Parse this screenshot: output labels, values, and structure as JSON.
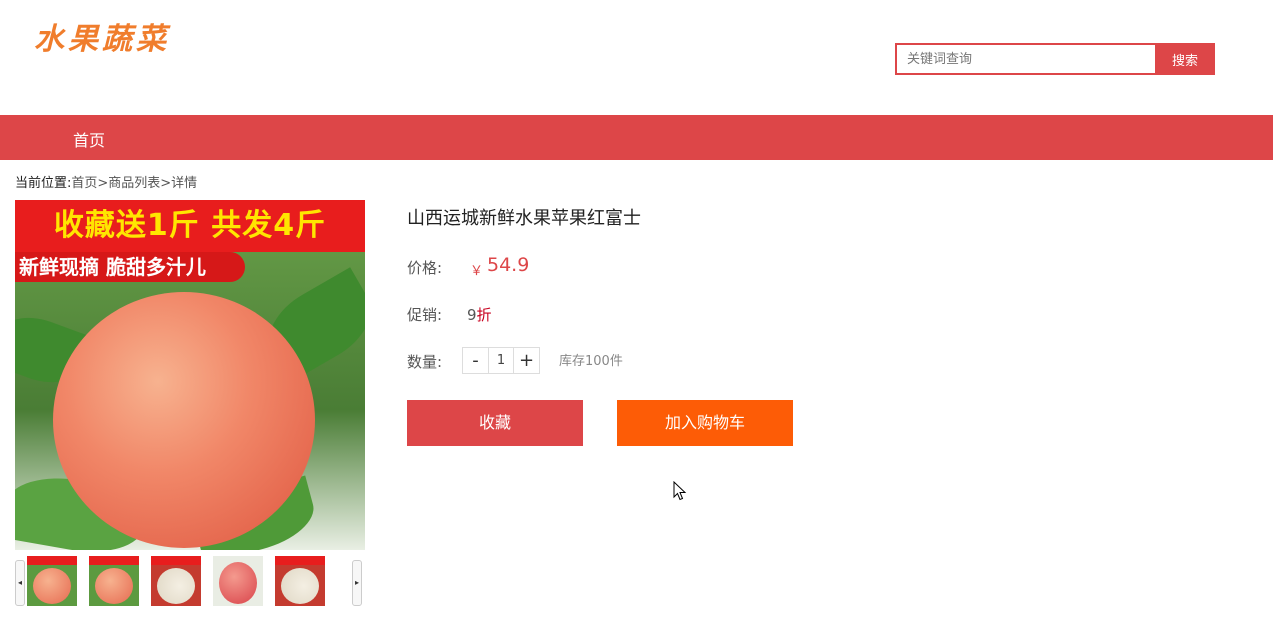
{
  "header": {
    "logo_text": "水果蔬菜",
    "search_placeholder": "关键词查询",
    "search_button": "搜索"
  },
  "nav": {
    "items": [
      {
        "label": "首页"
      }
    ]
  },
  "breadcrumb": {
    "lead": "当前位置:",
    "path": "首页>商品列表>详情"
  },
  "gallery": {
    "banner_main": "收藏送1斤 共发4斤",
    "banner_sub": "新鲜现摘 脆甜多汁儿",
    "arrow_left": "◂",
    "arrow_right": "▸",
    "thumbnail_count": 5
  },
  "product": {
    "title": "山西运城新鲜水果苹果红富士",
    "price_label": "价格:",
    "currency": "￥",
    "price": "54.9",
    "promo_label": "促销:",
    "promo_value": "9",
    "promo_unit": "折",
    "qty_label": "数量:",
    "qty_minus": "-",
    "qty_value": "1",
    "qty_plus": "+",
    "stock": "库存100件",
    "favorite_button": "收藏",
    "cart_button": "加入购物车"
  },
  "colors": {
    "primary": "#dd4648",
    "cart": "#fd5c06",
    "logo": "#f07d2c"
  }
}
